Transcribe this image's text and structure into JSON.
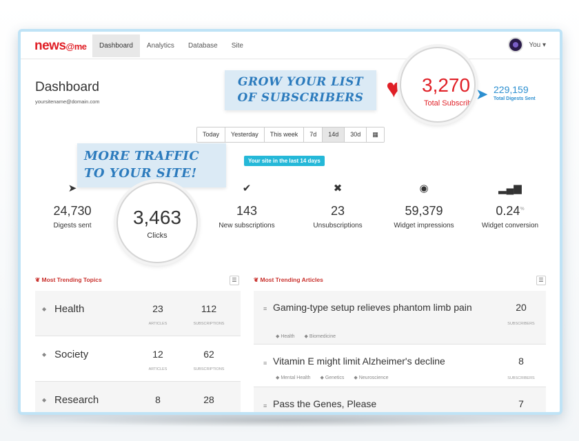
{
  "nav": {
    "logo_main": "news",
    "logo_at": "@me",
    "items": [
      {
        "label": "Dashboard",
        "active": true
      },
      {
        "label": "Analytics",
        "active": false
      },
      {
        "label": "Database",
        "active": false
      },
      {
        "label": "Site",
        "active": false
      }
    ],
    "user": "You ▾"
  },
  "header": {
    "title": "Dashboard",
    "site": "yoursitename@domain.com"
  },
  "callouts": {
    "grow": "Grow your list of subscribers",
    "traffic": "More traffic to your site!"
  },
  "subscribers": {
    "value": "3,270",
    "label": "Total Subscribers"
  },
  "digests_total": {
    "value": "229,159",
    "label": "Total Digests Sent"
  },
  "range": {
    "options": [
      "Today",
      "Yesterday",
      "This week",
      "7d",
      "14d",
      "30d",
      "▦"
    ],
    "selected": "14d"
  },
  "period_badge": "Your site in the last 14 days",
  "stats": {
    "digests": {
      "value": "24,730",
      "label": "Digests sent"
    },
    "clicks": {
      "value": "3,463",
      "label": "Clicks"
    },
    "new_subs": {
      "value": "143",
      "label": "New subscriptions"
    },
    "unsubs": {
      "value": "23",
      "label": "Unsubscriptions"
    },
    "impressions": {
      "value": "59,379",
      "label": "Widget impressions"
    },
    "conversion": {
      "value": "0.24",
      "unit": "%",
      "label": "Widget conversion"
    }
  },
  "topics": {
    "heading": "Most Trending Topics",
    "rows": [
      {
        "name": "Health",
        "articles": "23",
        "subscriptions": "112"
      },
      {
        "name": "Society",
        "articles": "12",
        "subscriptions": "62"
      },
      {
        "name": "Research",
        "articles": "8",
        "subscriptions": "28"
      }
    ],
    "col_articles": "ARTICLES",
    "col_subscriptions": "SUBSCRIPTIONS"
  },
  "articles": {
    "heading": "Most Trending Articles",
    "rows": [
      {
        "title": "Gaming-type setup relieves phantom limb pain",
        "tags": [
          "Health",
          "Biomedicine"
        ],
        "subscribers": "20"
      },
      {
        "title": "Vitamin E might limit Alzheimer's decline",
        "tags": [
          "Mental Health",
          "Genetics",
          "Neuroscience"
        ],
        "subscribers": "8"
      },
      {
        "title": "Pass the Genes, Please",
        "tags": [],
        "subscribers": "7"
      }
    ],
    "col_subscribers": "SUBSCRIBERS"
  },
  "colors": {
    "brand_red": "#e01f26",
    "accent_blue": "#2c8fd0",
    "badge_cyan": "#25b8d8",
    "frame_blue": "#bfe3f6"
  }
}
